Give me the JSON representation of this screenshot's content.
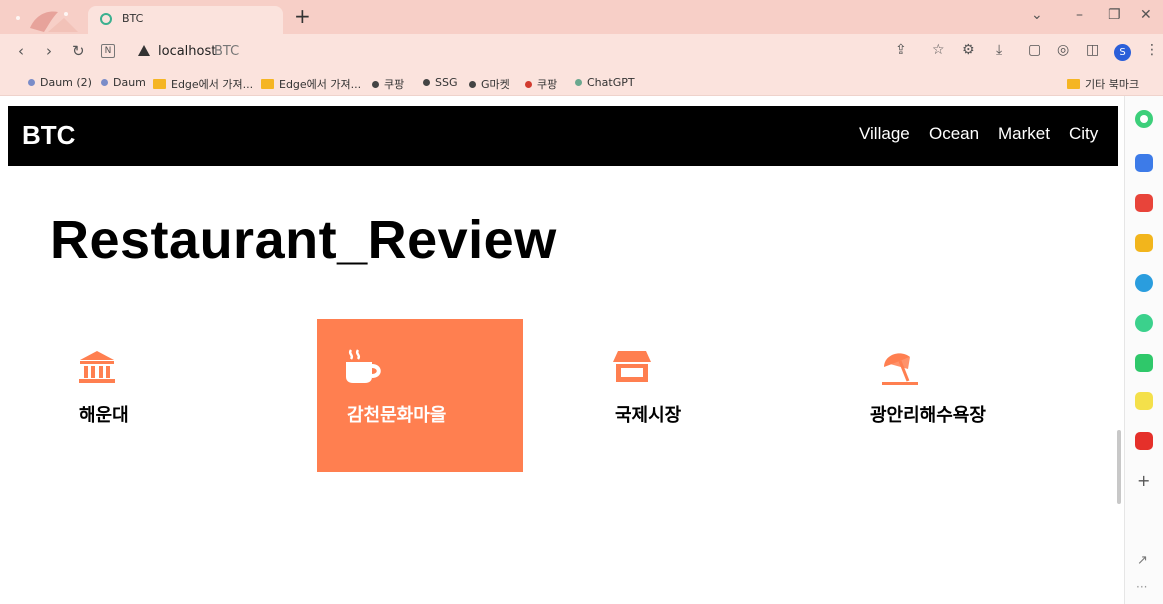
{
  "browser": {
    "tab_title": "BTC",
    "new_tab_symbol": "+",
    "url_host": "localhost",
    "url_rest": "BTC",
    "profile_initial": "S",
    "icons": [
      "back-icon",
      "forward-icon",
      "reload-icon",
      "reader-icon",
      "share-icon",
      "favorite-icon",
      "extensions-icon",
      "download-icon",
      "screenshot-icon",
      "collections-icon",
      "split-icon",
      "more-icon"
    ]
  },
  "bookmarks": {
    "items": [
      {
        "label": "Daum (2)",
        "kind": "dot",
        "color": "#7a8cc8"
      },
      {
        "label": "Daum",
        "kind": "dot",
        "color": "#7a8cc8"
      },
      {
        "label": "Edge에서 가져...",
        "kind": "folder",
        "color": "#f5b523"
      },
      {
        "label": "Edge에서 가져...",
        "kind": "folder",
        "color": "#f5b523"
      },
      {
        "label": "쿠팡",
        "kind": "dot",
        "color": "#444444"
      },
      {
        "label": "SSG",
        "kind": "dot",
        "color": "#444444"
      },
      {
        "label": "G마켓",
        "kind": "dot",
        "color": "#444444"
      },
      {
        "label": "쿠팡",
        "kind": "dot",
        "color": "#d23b2f"
      },
      {
        "label": "ChatGPT",
        "kind": "dot",
        "color": "#6aa88f"
      }
    ],
    "other_label": "기타 북마크"
  },
  "site": {
    "brand": "BTC",
    "menu": [
      "Village",
      "Ocean",
      "Market",
      "City"
    ],
    "title": "Restaurant_Review",
    "accent_color": "#ff7f50",
    "cards": [
      {
        "label": "해운대",
        "icon": "landmark-icon",
        "active": false
      },
      {
        "label": "감천문화마을",
        "icon": "coffee-icon",
        "active": true
      },
      {
        "label": "국제시장",
        "icon": "store-icon",
        "active": false
      },
      {
        "label": "광안리해수욕장",
        "icon": "beach-umbrella-icon",
        "active": false
      }
    ]
  },
  "sidebar": {
    "icons": [
      "copilot-icon",
      "tools-icon",
      "pocket-icon",
      "favorites-icon",
      "edge-drop-icon",
      "player-icon",
      "webtoon-icon",
      "notes-icon",
      "how-icon"
    ],
    "add_symbol": "+"
  }
}
